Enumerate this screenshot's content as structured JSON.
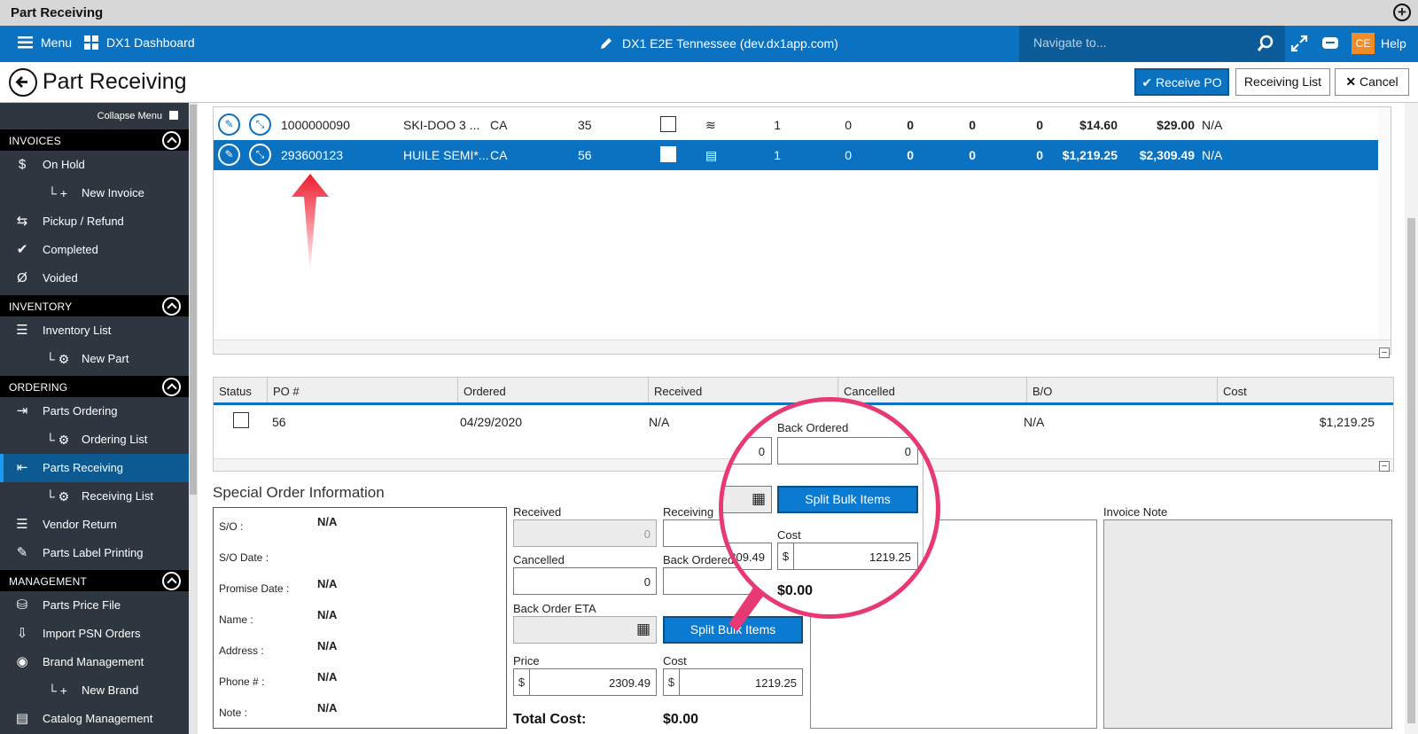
{
  "window": {
    "title": "Part Receiving"
  },
  "topnav": {
    "menu_label": "Menu",
    "dashboard_label": "DX1 Dashboard",
    "center_label": "DX1 E2E Tennessee (dev.dx1app.com)",
    "search_placeholder": "Navigate to...",
    "avatar_initials": "CE",
    "help_label": "Help",
    "accent": "#0a72c0"
  },
  "page": {
    "title": "Part Receiving",
    "buttons": {
      "receive_po": "Receive PO",
      "receiving_list": "Receiving List",
      "cancel": "Cancel"
    }
  },
  "sidebar": {
    "collapse_label": "Collapse Menu",
    "sections": [
      {
        "title": "INVOICES",
        "items": [
          {
            "label": "On Hold",
            "icon": "dollar-icon"
          },
          {
            "label": "New Invoice",
            "icon": "plus-icon",
            "sub": true
          },
          {
            "label": "Pickup / Refund",
            "icon": "refund-icon"
          },
          {
            "label": "Completed",
            "icon": "check-icon"
          },
          {
            "label": "Voided",
            "icon": "void-icon"
          }
        ]
      },
      {
        "title": "INVENTORY",
        "items": [
          {
            "label": "Inventory List",
            "icon": "list-icon"
          },
          {
            "label": "New Part",
            "icon": "gear-icon",
            "sub": true
          }
        ]
      },
      {
        "title": "ORDERING",
        "items": [
          {
            "label": "Parts Ordering",
            "icon": "order-icon"
          },
          {
            "label": "Ordering List",
            "icon": "gear-icon",
            "sub": true
          },
          {
            "label": "Parts Receiving",
            "icon": "receive-icon",
            "active": true
          },
          {
            "label": "Receiving List",
            "icon": "gear-icon",
            "sub": true
          },
          {
            "label": "Vendor Return",
            "icon": "list-icon"
          },
          {
            "label": "Parts Label Printing",
            "icon": "label-icon"
          }
        ]
      },
      {
        "title": "MANAGEMENT",
        "items": [
          {
            "label": "Parts Price File",
            "icon": "price-icon"
          },
          {
            "label": "Import PSN Orders",
            "icon": "import-icon"
          },
          {
            "label": "Brand Management",
            "icon": "brand-icon"
          },
          {
            "label": "New Brand",
            "icon": "plus-icon",
            "sub": true
          },
          {
            "label": "Catalog Management",
            "icon": "catalog-icon"
          }
        ]
      }
    ]
  },
  "parts_grid": {
    "rows": [
      {
        "part": "1000000090",
        "desc": "SKI-DOO 3 ...",
        "unit": "CA",
        "qty": "35",
        "icon": "layers-icon",
        "c1": "1",
        "c2": "0",
        "c3": "0",
        "c4": "0",
        "c5": "0",
        "cost": "$14.60",
        "price": "$29.00",
        "status": "N/A",
        "selected": false
      },
      {
        "part": "293600123",
        "desc": "HUILE SEMI*...",
        "unit": "CA",
        "qty": "56",
        "icon": "document-icon",
        "c1": "1",
        "c2": "0",
        "c3": "0",
        "c4": "0",
        "c5": "0",
        "cost": "$1,219.25",
        "price": "$2,309.49",
        "status": "N/A",
        "selected": true
      }
    ]
  },
  "po_grid": {
    "headers": [
      "Status",
      "PO #",
      "Ordered",
      "Received",
      "Cancelled",
      "B/O",
      "Cost"
    ],
    "rows": [
      {
        "po": "56",
        "ordered": "04/29/2020",
        "received": "N/A",
        "bo": "N/A",
        "cost": "$1,219.25"
      }
    ]
  },
  "special_order": {
    "title": "Special Order Information",
    "fields": [
      {
        "label": "S/O :",
        "value": "N/A"
      },
      {
        "label": "S/O Date :",
        "value": ""
      },
      {
        "label": "Promise Date :",
        "value": "N/A"
      },
      {
        "label": "Name :",
        "value": "N/A"
      },
      {
        "label": "Address :",
        "value": "N/A"
      },
      {
        "label": "Phone # :",
        "value": "N/A"
      },
      {
        "label": "Note :",
        "value": "N/A"
      }
    ]
  },
  "form": {
    "received_label": "Received",
    "received_value": "0",
    "receiving_label": "Receiving",
    "receiving_value": "2309.49",
    "cancelled_label": "Cancelled",
    "cancelled_value": "0",
    "back_ordered_label": "Back Ordered",
    "back_ordered_value": "0",
    "back_order_eta_label": "Back Order ETA",
    "split_label": "Split Bulk Items",
    "price_label": "Price",
    "price_value": "2309.49",
    "cost_label": "Cost",
    "cost_value": "1219.25",
    "currency": "$",
    "total_cost_label": "Total Cost:",
    "total_cost_value": "$0.00",
    "invoice_note_label": "Invoice Note"
  },
  "zoom": {
    "back_ordered_label": "Back Ordered",
    "back_ordered_value": "0",
    "left_value": "0",
    "split_label": "Split Bulk Items",
    "cost_label": "Cost",
    "cost_value": "1219.25",
    "left_cost": "309.49",
    "total": "$0.00",
    "ring_color": "#e73a72"
  }
}
